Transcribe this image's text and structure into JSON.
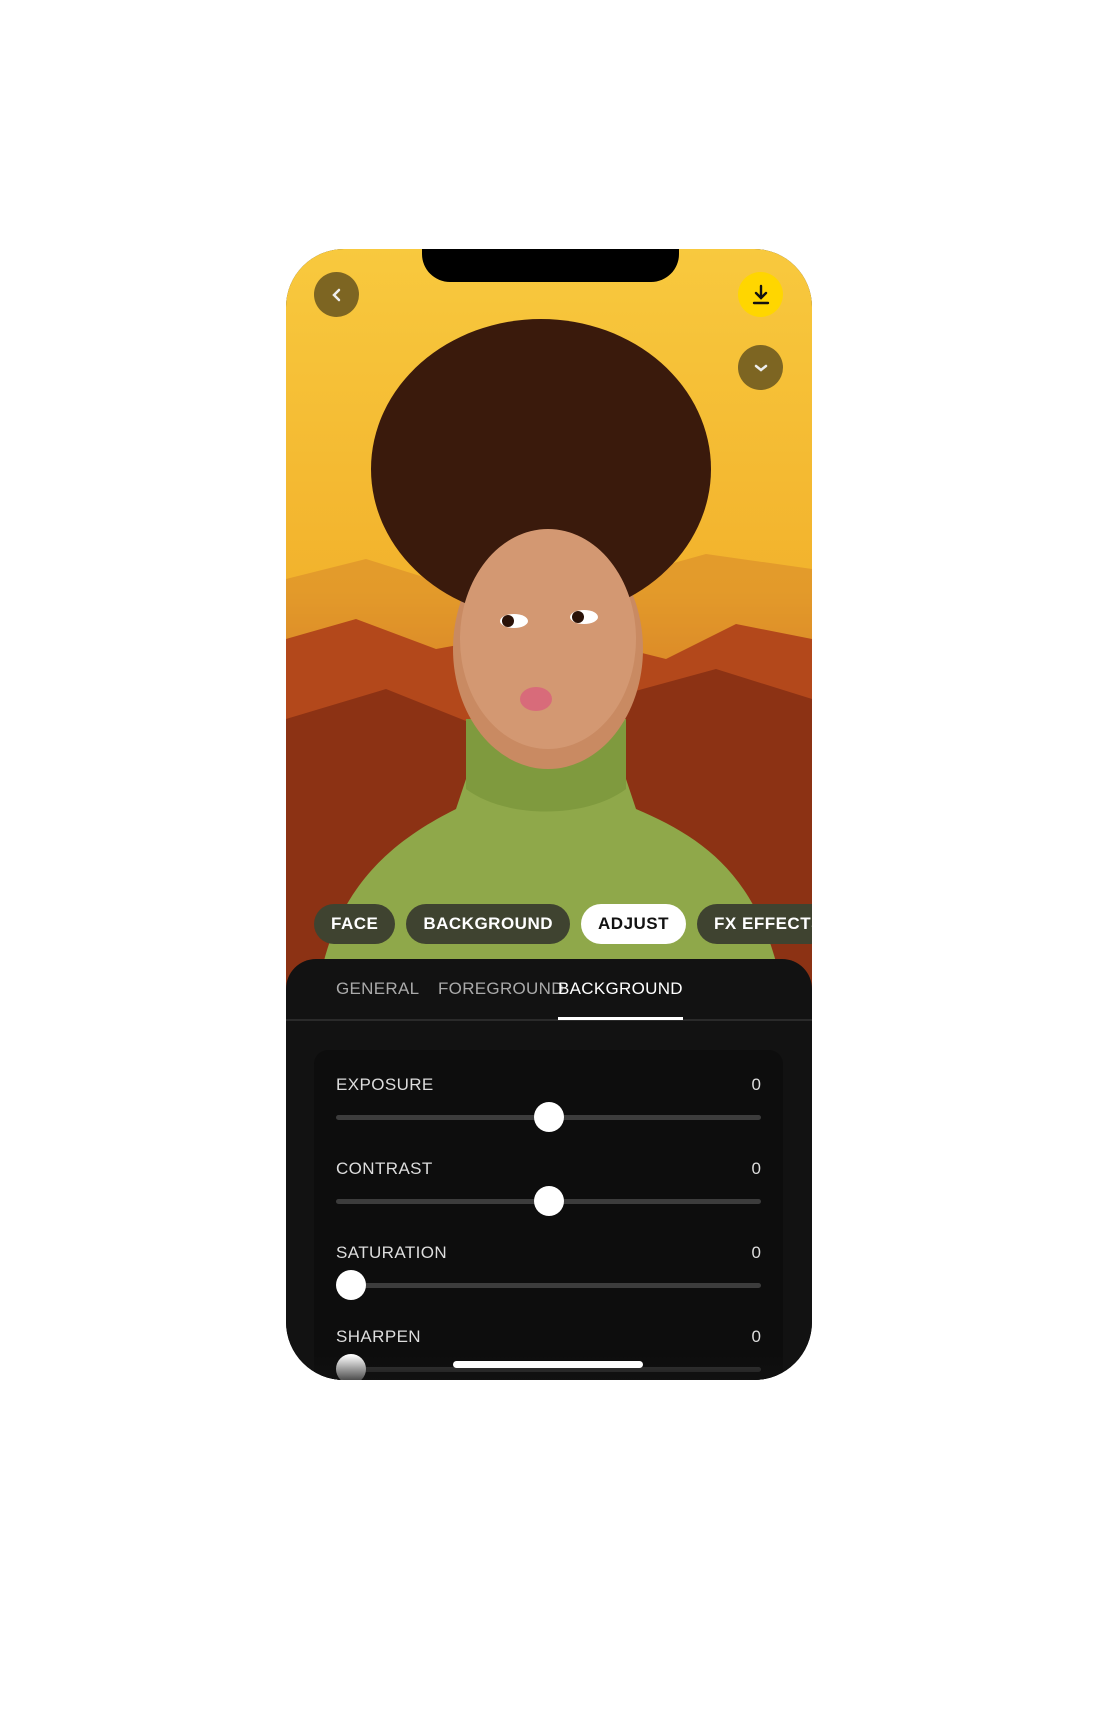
{
  "header": {
    "back_icon": "chevron-left-icon",
    "download_icon": "download-icon",
    "collapse_icon": "chevron-down-icon",
    "download_color": "#FFD600"
  },
  "chips": [
    {
      "label": "FACE"
    },
    {
      "label": "BACKGROUND"
    },
    {
      "label": "ADJUST",
      "active": true
    },
    {
      "label": "FX EFFECTS"
    }
  ],
  "tabs": [
    {
      "label": "GENERAL"
    },
    {
      "label": "FOREGROUND"
    },
    {
      "label": "BACKGROUND",
      "active": true
    }
  ],
  "sliders": [
    {
      "label": "EXPOSURE",
      "value": "0",
      "position": 0.5
    },
    {
      "label": "CONTRAST",
      "value": "0",
      "position": 0.5
    },
    {
      "label": "SATURATION",
      "value": "0",
      "position": 0
    },
    {
      "label": "SHARPEN",
      "value": "0",
      "position": 0
    }
  ]
}
